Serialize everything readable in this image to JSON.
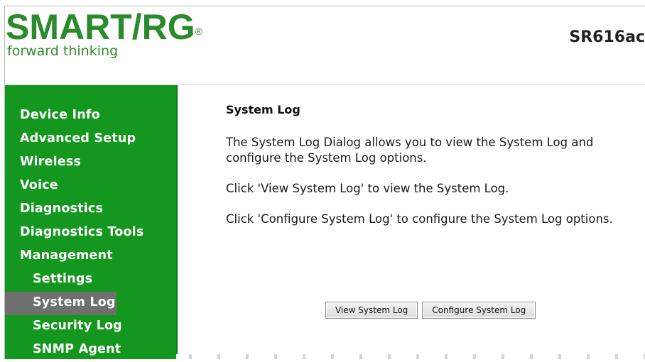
{
  "header": {
    "logo_main": "SMART/RG",
    "logo_reg": "®",
    "logo_tagline": "forward thinking",
    "model": "SR616ac"
  },
  "sidebar": {
    "items": [
      {
        "label": "Device Info"
      },
      {
        "label": "Advanced Setup"
      },
      {
        "label": "Wireless"
      },
      {
        "label": "Voice"
      },
      {
        "label": "Diagnostics"
      },
      {
        "label": "Diagnostics Tools"
      },
      {
        "label": "Management"
      },
      {
        "label": "Settings"
      },
      {
        "label": "System Log"
      },
      {
        "label": "Security Log"
      },
      {
        "label": "SNMP Agent"
      }
    ],
    "selected": "System Log"
  },
  "main": {
    "title": "System Log",
    "paragraphs": [
      "The System Log Dialog allows you to view the System Log and configure the System Log options.",
      "Click 'View System Log' to view the System Log.",
      "Click 'Configure System Log' to configure the System Log options."
    ],
    "buttons": {
      "view": "View System Log",
      "configure": "Configure System Log"
    }
  },
  "colors": {
    "brand_green": "#2b8a2b",
    "sidebar_bg": "#13971f",
    "selected_bg": "#6f6f6f"
  }
}
